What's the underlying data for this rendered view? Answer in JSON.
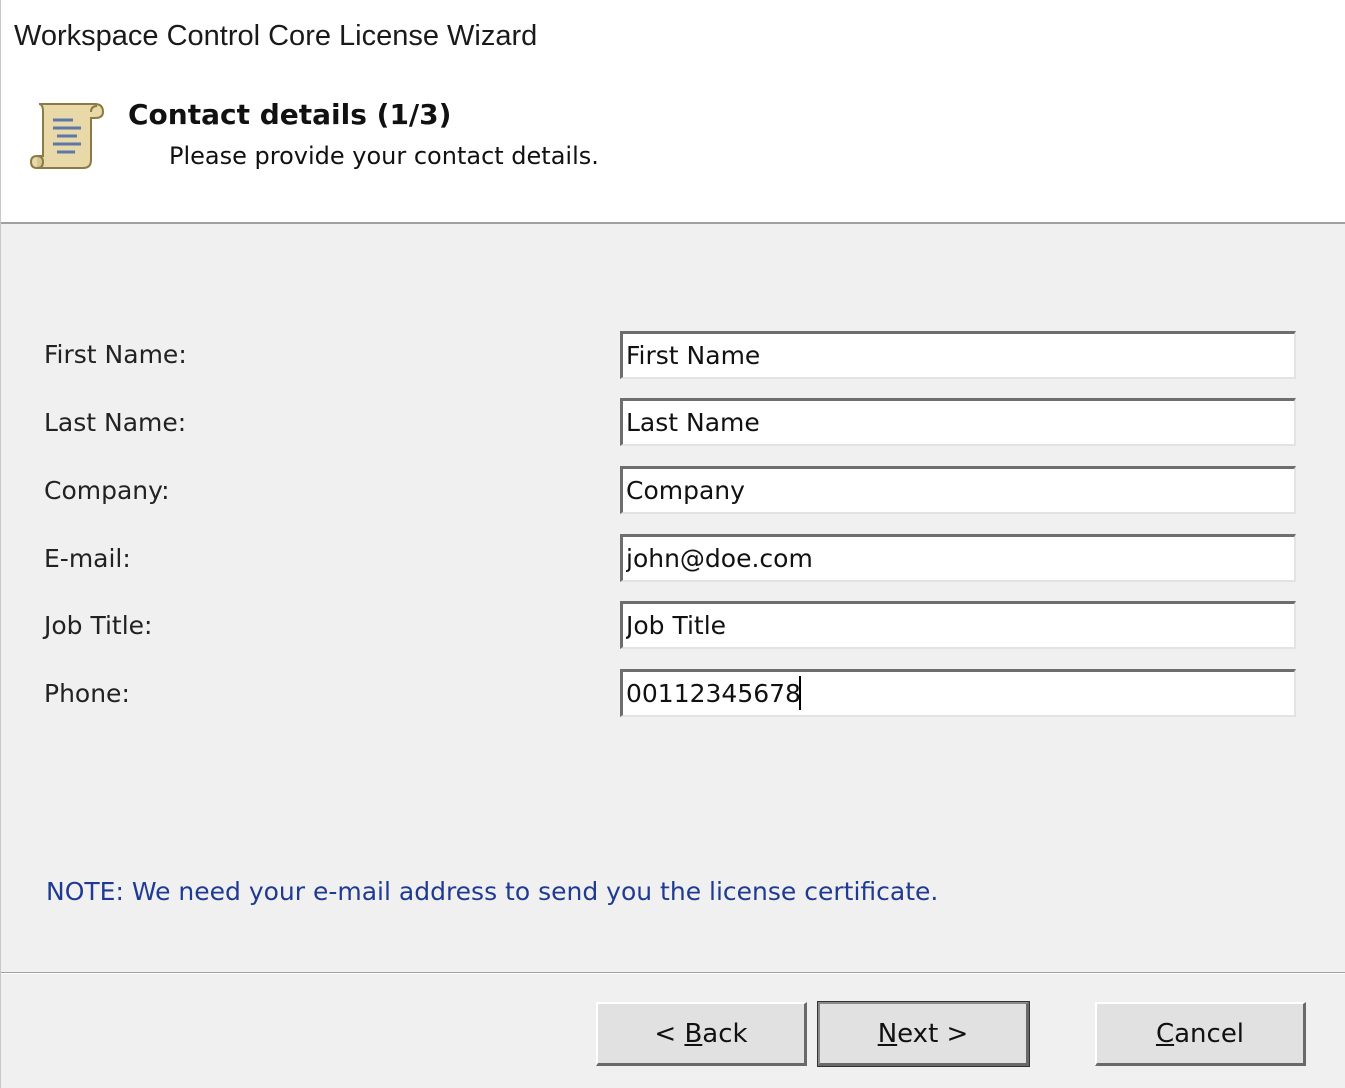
{
  "window": {
    "title": "Workspace Control Core License Wizard"
  },
  "header": {
    "icon": "scroll-icon",
    "title": "Contact details (1/3)",
    "subtitle": "Please provide your contact details."
  },
  "form": {
    "fields": [
      {
        "label": "First Name:",
        "value": "First Name"
      },
      {
        "label": "Last Name:",
        "value": "Last Name"
      },
      {
        "label": "Company:",
        "value": "Company"
      },
      {
        "label": "E-mail:",
        "value": "john@doe.com"
      },
      {
        "label": "Job Title:",
        "value": "Job Title"
      },
      {
        "label": "Phone:",
        "value": "00112345678"
      }
    ]
  },
  "note": "NOTE: We need your e-mail address to send you the license certificate.",
  "buttons": {
    "back": {
      "prefix": "< ",
      "accel": "B",
      "rest": "ack"
    },
    "next": {
      "prefix": "",
      "accel": "N",
      "rest": "ext >"
    },
    "cancel": {
      "prefix": "",
      "accel": "C",
      "rest": "ancel"
    }
  }
}
